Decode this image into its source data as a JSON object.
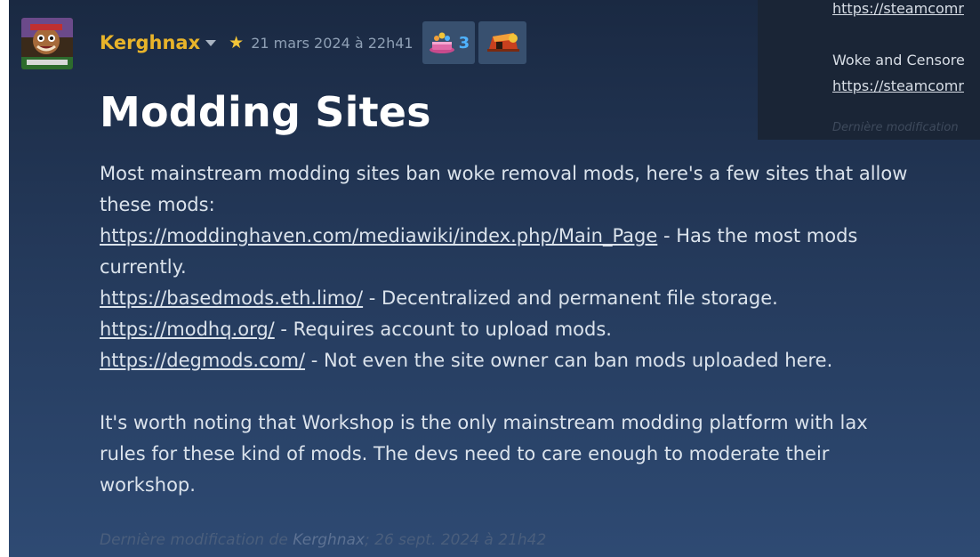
{
  "post": {
    "author": "Kerghnax",
    "date": "21 mars 2024 à 22h41",
    "award_count": "3",
    "title": "Modding Sites",
    "intro_line1": "Most mainstream modding sites ban woke removal mods, here's a few sites that allow",
    "intro_line2": "these mods:",
    "sites": [
      {
        "url": "https://moddinghaven.com/mediawiki/index.php/Main_Page",
        "desc": " - Has the most mods"
      },
      {
        "url": "https://basedmods.eth.limo/",
        "desc": " - Decentralized and permanent file storage."
      },
      {
        "url": "https://modhq.org/",
        "desc": " - Requires account to upload mods."
      },
      {
        "url": "https://degmods.com/",
        "desc": " - Not even the site owner can ban mods uploaded here."
      }
    ],
    "site0_desc_cont": "currently.",
    "outro_line1": "It's worth noting that Workshop is the only mainstream modding platform with lax",
    "outro_line2": "rules for these kind of mods. The devs need to care enough to moderate their",
    "outro_line3": "workshop.",
    "last_edited_prefix": "Dernière modification de ",
    "last_edited_author": "Kerghnax",
    "last_edited_suffix": "; 26 sept. 2024 à 21h42"
  },
  "side_panel": {
    "link1": "https://steamcomr",
    "text1": "Woke and Censore",
    "link2": "https://steamcomr",
    "edited": "Dernière modification"
  },
  "icons": {
    "star": "star-icon",
    "dropdown": "chevron-down-icon",
    "award1": "cake-award-icon",
    "award2": "horn-award-icon"
  },
  "colors": {
    "author": "#e8b32a",
    "star": "#f2c438",
    "award_count": "#4fb3ff",
    "body_text": "#dbe3ec",
    "title": "#ffffff"
  }
}
